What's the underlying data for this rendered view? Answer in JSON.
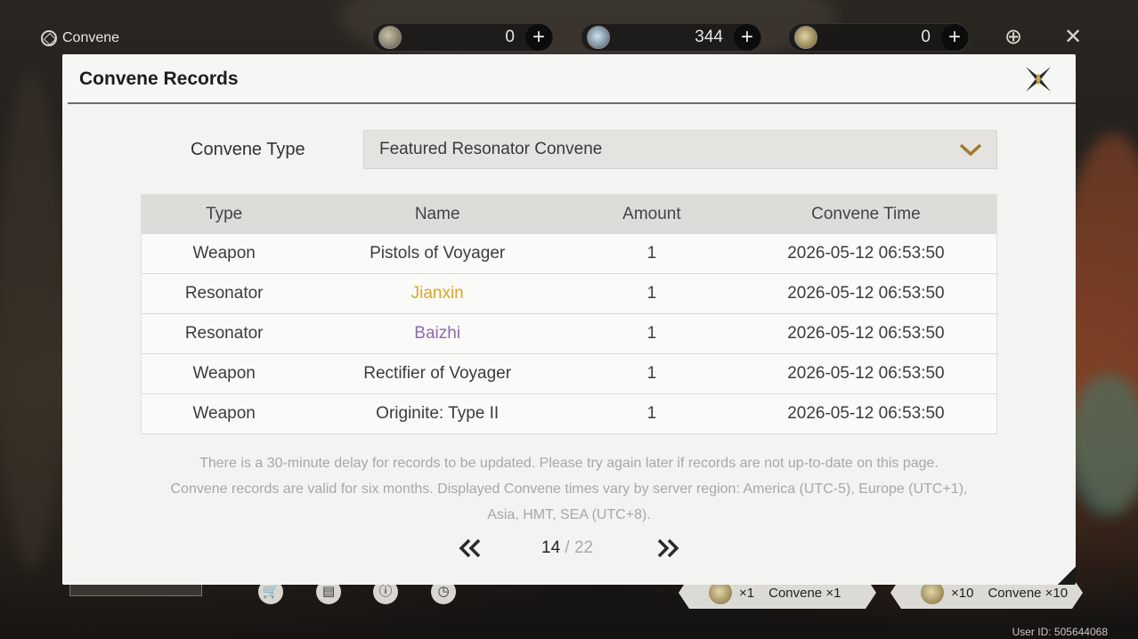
{
  "app": {
    "section_title": "Convene",
    "user_id": "User ID: 505644068"
  },
  "currencies": [
    {
      "name": "astrite-currency",
      "value": "0"
    },
    {
      "name": "lunite-currency",
      "value": "344"
    },
    {
      "name": "tide-currency",
      "value": "0"
    }
  ],
  "modal": {
    "title": "Convene Records",
    "type_label": "Convene Type",
    "type_selected": "Featured Resonator Convene",
    "columns": [
      "Type",
      "Name",
      "Amount",
      "Convene Time"
    ],
    "rows": [
      {
        "type": "Weapon",
        "name": "Pistols of Voyager",
        "amount": "1",
        "time": "2026-05-12 06:53:50",
        "color": "#3c3c3c"
      },
      {
        "type": "Resonator",
        "name": "Jianxin",
        "amount": "1",
        "time": "2026-05-12 06:53:50",
        "color": "#d7a824"
      },
      {
        "type": "Resonator",
        "name": "Baizhi",
        "amount": "1",
        "time": "2026-05-12 06:53:50",
        "color": "#8f6ab0"
      },
      {
        "type": "Weapon",
        "name": "Rectifier of Voyager",
        "amount": "1",
        "time": "2026-05-12 06:53:50",
        "color": "#3c3c3c"
      },
      {
        "type": "Weapon",
        "name": "Originite: Type II",
        "amount": "1",
        "time": "2026-05-12 06:53:50",
        "color": "#3c3c3c"
      }
    ],
    "notice_line1": "There is a 30-minute delay for records to be updated. Please try again later if records are not up-to-date on this page.",
    "notice_line2": "Convene records are valid for six months. Displayed Convene times vary by server region: America (UTC-5), Europe (UTC+1),",
    "notice_line3": "Asia, HMT, SEA (UTC+8).",
    "pager": {
      "current": "14",
      "separator": "/",
      "total": "22"
    }
  },
  "bottom": {
    "convene_x1_count": "×1",
    "convene_x1_label": "Convene ×1",
    "convene_x10_count": "×10",
    "convene_x10_label": "Convene ×10"
  },
  "colors": {
    "rarity_5star": "#d7a824",
    "rarity_4star": "#8f6ab0",
    "accent_chevron": "#a07a2e"
  }
}
